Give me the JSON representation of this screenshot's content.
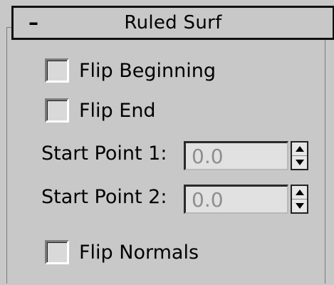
{
  "rollout": {
    "title": "Ruled Surf",
    "collapse_symbol": "–"
  },
  "checkboxes": {
    "flip_beginning": {
      "label": "Flip Beginning",
      "checked": false
    },
    "flip_end": {
      "label": "Flip End",
      "checked": false
    },
    "flip_normals": {
      "label": "Flip Normals",
      "checked": false
    }
  },
  "fields": {
    "start_point_1": {
      "label": "Start Point 1:",
      "value": "0.0"
    },
    "start_point_2": {
      "label": "Start Point 2:",
      "value": "0.0"
    }
  },
  "colors": {
    "panel_bg": "#c8c8c8",
    "field_bg": "#e1e1e1",
    "disabled_text": "#8e8e8e"
  },
  "icons": {
    "collapse": "minus-icon",
    "spinner_up": "arrow-up-icon",
    "spinner_down": "arrow-down-icon"
  }
}
